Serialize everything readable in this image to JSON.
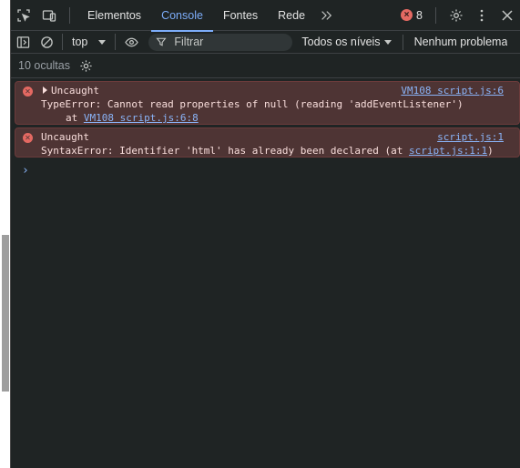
{
  "tabs": [
    "Elementos",
    "Console",
    "Fontes",
    "Rede"
  ],
  "active_tab": "Console",
  "error_count": "8",
  "toolbar": {
    "context": "top",
    "filter_placeholder": "Filtrar",
    "levels": "Todos os níveis",
    "problems": "Nenhum problema"
  },
  "status": {
    "hidden": "10 ocultas"
  },
  "messages": [
    {
      "title": "Uncaught",
      "source": "VM108 script.js:6",
      "line2": "TypeError: Cannot read properties of null (reading 'addEventListener')",
      "line3_prefix": "at ",
      "line3_link": "VM108 script.js:6:8"
    },
    {
      "title": "Uncaught",
      "source": "script.js:1",
      "line2_prefix": "SyntaxError: Identifier 'html' has already been declared (at ",
      "line2_link": "script.js:1:1",
      "line2_suffix": ")"
    }
  ],
  "prompt_symbol": "›",
  "colors": {
    "error": "#e46962",
    "accent": "#7cacf8",
    "link": "#8ab4f8",
    "error_bg": "#4e3434"
  }
}
